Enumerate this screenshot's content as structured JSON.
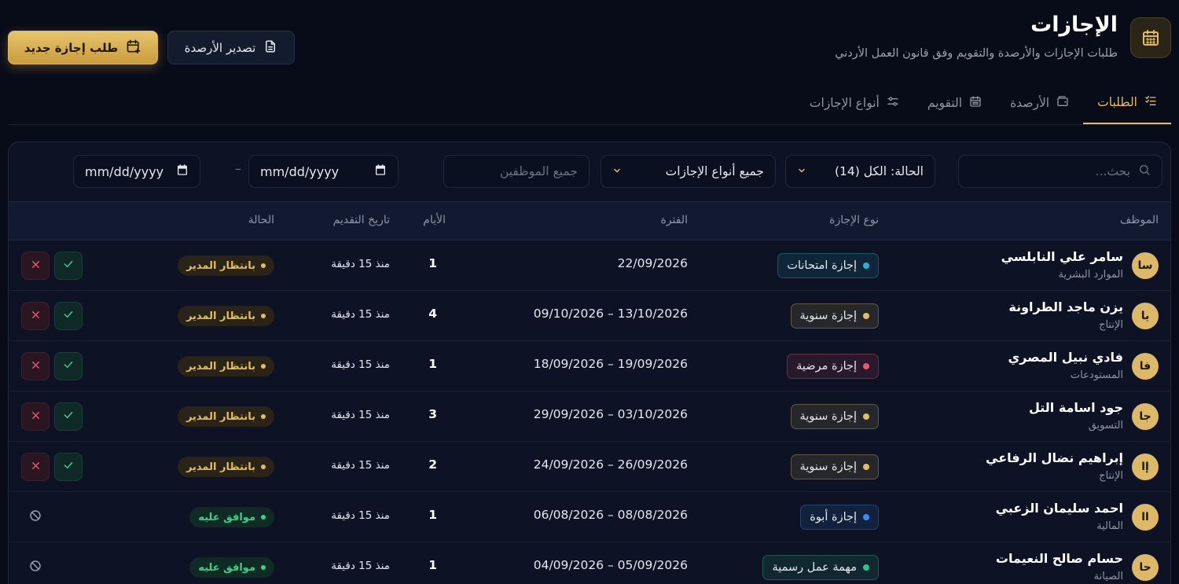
{
  "header": {
    "title": "الإجازات",
    "subtitle": "طلبات الإجازات والأرصدة والتقويم وفق قانون العمل الأردني",
    "icon": "calendar-icon"
  },
  "actions": {
    "export_label": "تصدير الأرصدة",
    "new_request_label": "طلب إجازة جديد"
  },
  "tabs": [
    {
      "label": "الطلبات",
      "icon": "list-check-icon",
      "active": true
    },
    {
      "label": "الأرصدة",
      "icon": "wallet-icon",
      "active": false
    },
    {
      "label": "التقويم",
      "icon": "calendar-grid-icon",
      "active": false
    },
    {
      "label": "أنواع الإجازات",
      "icon": "sliders-icon",
      "active": false
    }
  ],
  "filters": {
    "search_placeholder": "بحث...",
    "status_value": "الحالة: الكل (14)",
    "type_value": "جميع أنواع الإجازات",
    "employees_placeholder": "جميع الموظفين",
    "date_from": "mm/dd/yyyy",
    "date_to": "mm/dd/yyyy",
    "date_separator": "–"
  },
  "table": {
    "columns": {
      "employee": "الموظف",
      "type": "نوع الإجازة",
      "period": "الفترة",
      "days": "الأيام",
      "submitted": "تاريخ التقديم",
      "status": "الحالة"
    },
    "rows": [
      {
        "initials": "سا",
        "name": "سامر علي النابلسي",
        "dept": "الموارد البشرية",
        "type": "إجازة امتحانات",
        "type_color": "#22b8cf",
        "period": "22/09/2026",
        "days": "1",
        "submitted": "منذ 15 دقيقة",
        "status": "بانتظار المدير",
        "status_kind": "pending"
      },
      {
        "initials": "يا",
        "name": "يزن ماجد الطراونة",
        "dept": "الإنتاج",
        "type": "إجازة سنوية",
        "type_color": "#e2bd62",
        "period": "09/10/2026 – 13/10/2026",
        "days": "4",
        "submitted": "منذ 15 دقيقة",
        "status": "بانتظار المدير",
        "status_kind": "pending"
      },
      {
        "initials": "فا",
        "name": "فادي نبيل المصري",
        "dept": "المستودعات",
        "type": "إجازة مرضية",
        "type_color": "#f0566b",
        "period": "18/09/2026 – 19/09/2026",
        "days": "1",
        "submitted": "منذ 15 دقيقة",
        "status": "بانتظار المدير",
        "status_kind": "pending"
      },
      {
        "initials": "جا",
        "name": "جود اسامة التل",
        "dept": "التسويق",
        "type": "إجازة سنوية",
        "type_color": "#e2bd62",
        "period": "29/09/2026 – 03/10/2026",
        "days": "3",
        "submitted": "منذ 15 دقيقة",
        "status": "بانتظار المدير",
        "status_kind": "pending"
      },
      {
        "initials": "إا",
        "name": "إبراهيم نضال الرفاعي",
        "dept": "الإنتاج",
        "type": "إجازة سنوية",
        "type_color": "#e2bd62",
        "period": "24/09/2026 – 26/09/2026",
        "days": "2",
        "submitted": "منذ 15 دقيقة",
        "status": "بانتظار المدير",
        "status_kind": "pending"
      },
      {
        "initials": "اا",
        "name": "احمد سليمان الزعبي",
        "dept": "المالية",
        "type": "إجازة أبوة",
        "type_color": "#3b8cf0",
        "period": "06/08/2026 – 08/08/2026",
        "days": "1",
        "submitted": "منذ 15 دقيقة",
        "status": "موافق عليه",
        "status_kind": "approved"
      },
      {
        "initials": "حا",
        "name": "حسام صالح النعيمات",
        "dept": "الصيانة",
        "type": "مهمة عمل رسمية",
        "type_color": "#2ec48a",
        "period": "04/09/2026 – 05/09/2026",
        "days": "1",
        "submitted": "منذ 15 دقيقة",
        "status": "موافق عليه",
        "status_kind": "approved"
      }
    ]
  },
  "colors": {
    "accent": "#e2bd62",
    "background": "#080c19",
    "panel": "#0d1324",
    "pending": "#e2bd62",
    "approved": "#3ecf8e"
  }
}
